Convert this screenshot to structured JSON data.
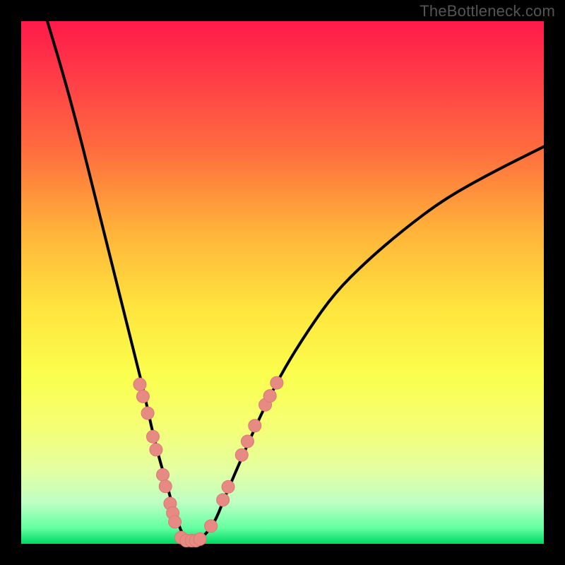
{
  "watermark": "TheBottleneck.com",
  "colors": {
    "curve": "#000000",
    "dot_fill": "#e88a84",
    "dot_stroke": "#d87a74",
    "frame": "#000000"
  },
  "chart_data": {
    "type": "line",
    "title": "",
    "xlabel": "",
    "ylabel": "",
    "xlim": [
      0,
      100
    ],
    "ylim": [
      0,
      100
    ],
    "series": [
      {
        "name": "bottleneck-curve",
        "x": [
          5,
          8,
          11,
          14,
          17,
          19.5,
          21.5,
          23.5,
          25,
          26.5,
          28,
          29,
          30,
          31,
          32,
          33.5,
          35,
          37,
          39,
          42,
          46,
          50,
          55,
          60,
          66,
          73,
          81,
          90,
          100
        ],
        "y": [
          100,
          90,
          79,
          67,
          55,
          45,
          37,
          29,
          22,
          16,
          11,
          7,
          4,
          1.5,
          0.5,
          0.5,
          1.5,
          4,
          9,
          16,
          25,
          33,
          41,
          48,
          54,
          60,
          66,
          71,
          76
        ]
      }
    ],
    "dots": {
      "name": "marker-dots",
      "points": [
        {
          "x": 22.7,
          "y": 30.5
        },
        {
          "x": 23.3,
          "y": 28.2
        },
        {
          "x": 24.2,
          "y": 25.0
        },
        {
          "x": 25.2,
          "y": 20.5
        },
        {
          "x": 25.8,
          "y": 18.0
        },
        {
          "x": 27.1,
          "y": 13.2
        },
        {
          "x": 27.6,
          "y": 11.0
        },
        {
          "x": 28.5,
          "y": 7.7
        },
        {
          "x": 29.0,
          "y": 5.9
        },
        {
          "x": 29.4,
          "y": 4.2
        },
        {
          "x": 30.6,
          "y": 1.2
        },
        {
          "x": 31.6,
          "y": 0.6
        },
        {
          "x": 32.6,
          "y": 0.6
        },
        {
          "x": 33.4,
          "y": 0.6
        },
        {
          "x": 34.2,
          "y": 0.9
        },
        {
          "x": 36.3,
          "y": 3.4
        },
        {
          "x": 38.6,
          "y": 8.4
        },
        {
          "x": 39.6,
          "y": 10.9
        },
        {
          "x": 42.2,
          "y": 17.0
        },
        {
          "x": 43.3,
          "y": 19.6
        },
        {
          "x": 44.7,
          "y": 22.6
        },
        {
          "x": 46.7,
          "y": 26.6
        },
        {
          "x": 47.6,
          "y": 28.3
        },
        {
          "x": 48.9,
          "y": 30.8
        }
      ]
    }
  }
}
